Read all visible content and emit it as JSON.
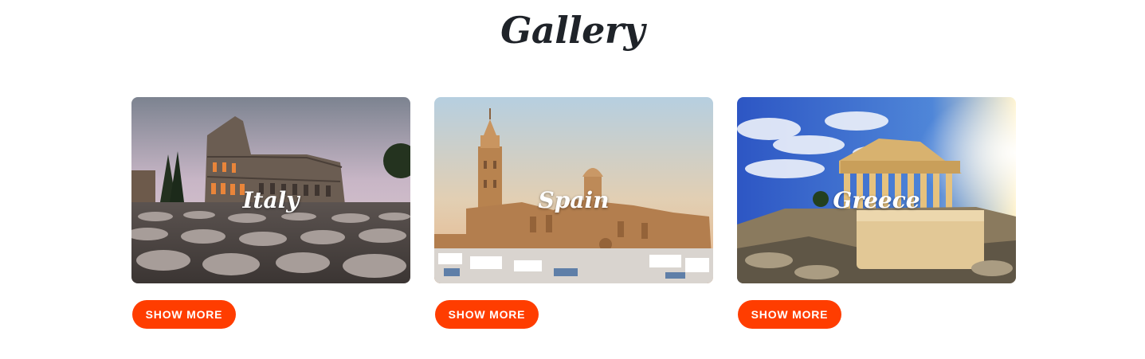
{
  "page": {
    "title": "Gallery"
  },
  "gallery": {
    "cards": [
      {
        "label": "Italy",
        "button_label": "SHOW MORE",
        "image": "colosseum-photo"
      },
      {
        "label": "Spain",
        "button_label": "SHOW MORE",
        "image": "seville-cathedral-photo"
      },
      {
        "label": "Greece",
        "button_label": "SHOW MORE",
        "image": "parthenon-photo"
      }
    ]
  },
  "colors": {
    "accent": "#ff3d00",
    "title_text": "#1f2329",
    "card_label_text": "#ffffff"
  }
}
